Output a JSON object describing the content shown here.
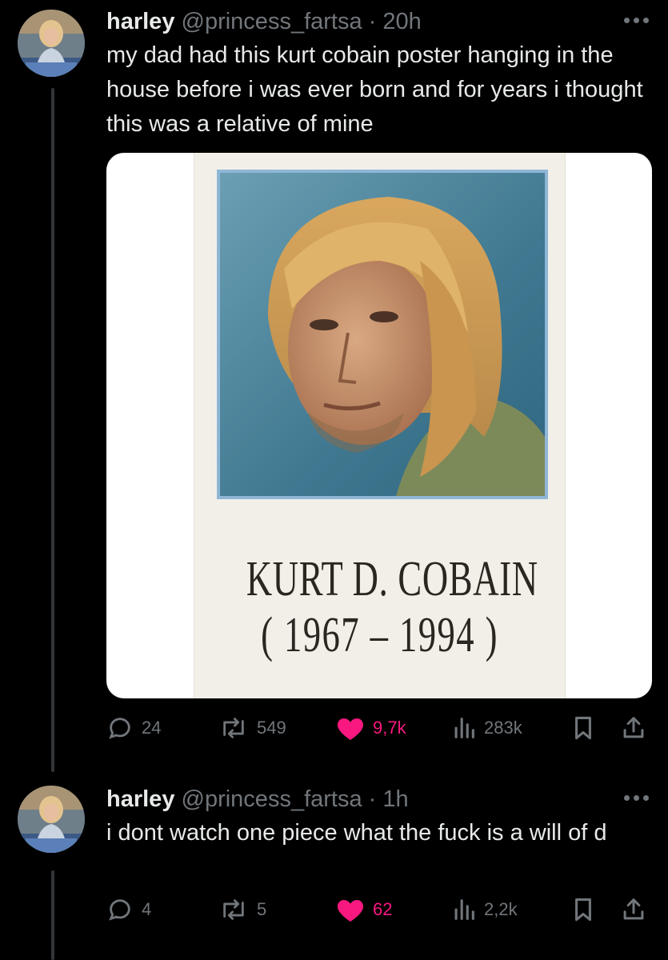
{
  "tweets": [
    {
      "name": "harley",
      "handle": "@princess_fartsa",
      "separator": "·",
      "time": "20h",
      "text": "my dad had this kurt cobain poster hanging in the house before i was ever born and for years i thought this was a relative of mine",
      "media": {
        "poster_name": "KURT D. COBAIN",
        "poster_years": "( 1967 – 1994 )"
      },
      "stats": {
        "replies": "24",
        "retweets": "549",
        "likes": "9,7k",
        "views": "283k"
      }
    },
    {
      "name": "harley",
      "handle": "@princess_fartsa",
      "separator": "·",
      "time": "1h",
      "text": "i dont watch one piece what the fuck is a will of d",
      "stats": {
        "replies": "4",
        "retweets": "5",
        "likes": "62",
        "views": "2,2k"
      }
    }
  ],
  "colors": {
    "background": "#000000",
    "text": "#e7e9ea",
    "muted": "#71767b",
    "like": "#f91880",
    "thread_line": "#333639"
  },
  "icons": [
    "reply-icon",
    "retweet-icon",
    "heart-icon",
    "views-icon",
    "bookmark-icon",
    "share-icon",
    "more-icon"
  ]
}
